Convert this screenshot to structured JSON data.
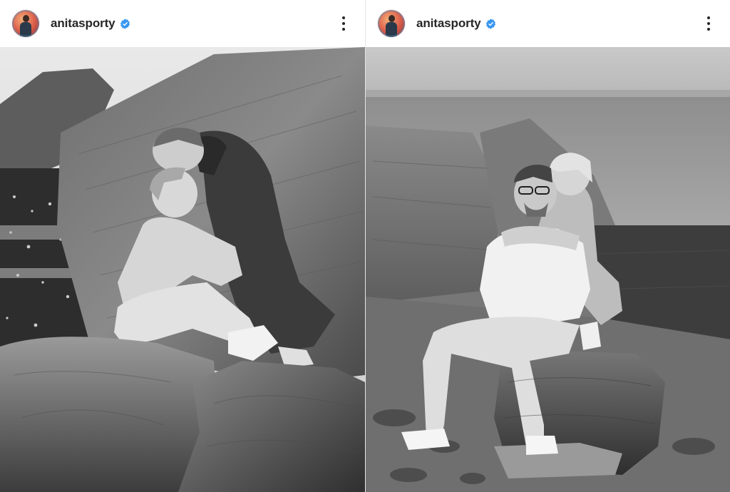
{
  "posts": [
    {
      "username": "anitasporty",
      "verified_icon": "verified-badge-icon",
      "more_icon": "more-options-icon",
      "photo": "photo-couple-on-rocks-kiss"
    },
    {
      "username": "anitasporty",
      "verified_icon": "verified-badge-icon",
      "more_icon": "more-options-icon",
      "photo": "photo-couple-on-rock-hug-by-sea"
    }
  ],
  "colors": {
    "verified_blue": "#3897f0",
    "text": "#262626",
    "avatar_accent": "#e0654e"
  }
}
